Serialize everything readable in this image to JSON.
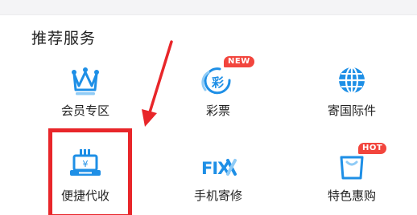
{
  "section": {
    "title": "推荐服务"
  },
  "services": [
    {
      "label": "会员专区",
      "icon": "crown-icon"
    },
    {
      "label": "彩票",
      "icon": "lottery-icon",
      "icon_text": "彩",
      "badge": "NEW"
    },
    {
      "label": "寄国际件",
      "icon": "globe-icon"
    },
    {
      "label": "便捷代收",
      "icon": "cash-register-icon",
      "icon_text": "¥"
    },
    {
      "label": "手机寄修",
      "icon": "fix-tools-icon",
      "icon_text": "FIX"
    },
    {
      "label": "特色惠购",
      "icon": "shopping-bag-icon",
      "badge": "HOT"
    }
  ],
  "colors": {
    "icon_blue": "#1e8fe6",
    "icon_light_blue": "#8fcbf6",
    "badge_red": "#f2453d",
    "highlight_red": "#e8262a"
  }
}
